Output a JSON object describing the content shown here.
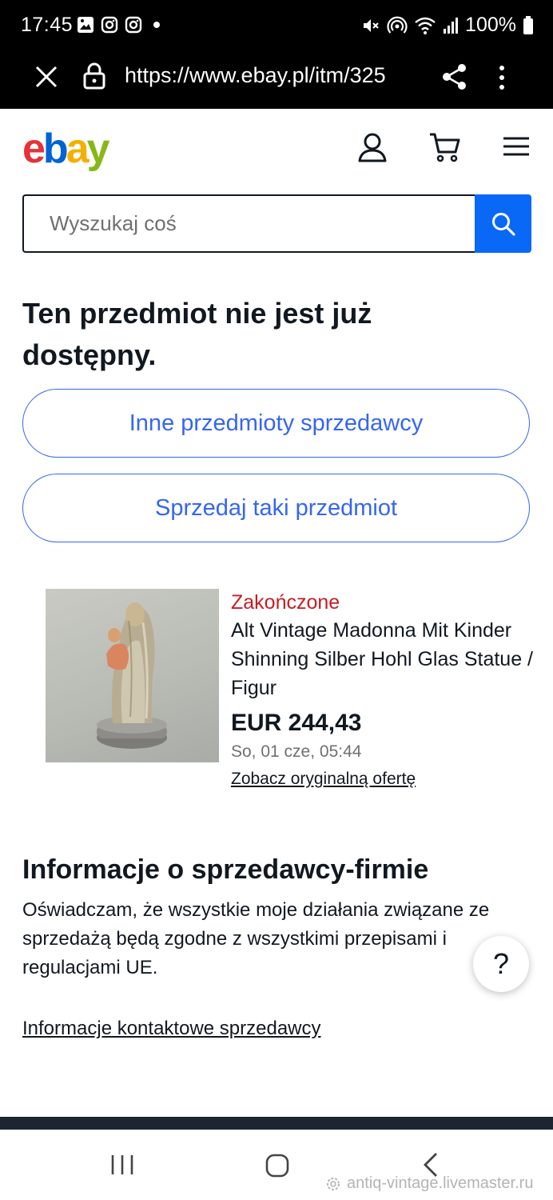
{
  "status_bar": {
    "time": "17:45",
    "battery": "100%"
  },
  "browser": {
    "url": "https://www.ebay.pl/itm/325"
  },
  "header": {
    "logo": {
      "e": "e",
      "b": "b",
      "a": "a",
      "y": "y"
    },
    "logo_colors": {
      "e": "#e53238",
      "b": "#0064d2",
      "a": "#f5af02",
      "y": "#86b817"
    }
  },
  "search": {
    "placeholder": "Wyszukaj coś",
    "button_color": "#0968f6"
  },
  "main": {
    "headline": "Ten przedmiot nie jest już dostępny.",
    "buttons": [
      {
        "label": "Inne przedmioty sprzedawcy"
      },
      {
        "label": "Sprzedaj taki przedmiot"
      }
    ]
  },
  "item": {
    "status": "Zakończone",
    "title": "Alt Vintage Madonna Mit Kinder Shinning Silber Hohl Glas Statue / Figur",
    "price": "EUR 244,43",
    "date": "So, 01 cze, 05:44",
    "link": "Zobacz oryginalną ofertę"
  },
  "seller": {
    "title": "Informacje o sprzedawcy-firmie",
    "text": "Oświadczam, że wszystkie moje działania związane ze sprzedażą będą zgodne z wszystkimi przepisami i regulacjami UE.",
    "contact_link": "Informacje kontaktowe sprzedawcy"
  },
  "help": {
    "label": "?"
  },
  "watermark": "antiq-vintage.livemaster.ru",
  "colors": {
    "accent_blue": "#3665f3",
    "ended_red": "#c41e24"
  }
}
